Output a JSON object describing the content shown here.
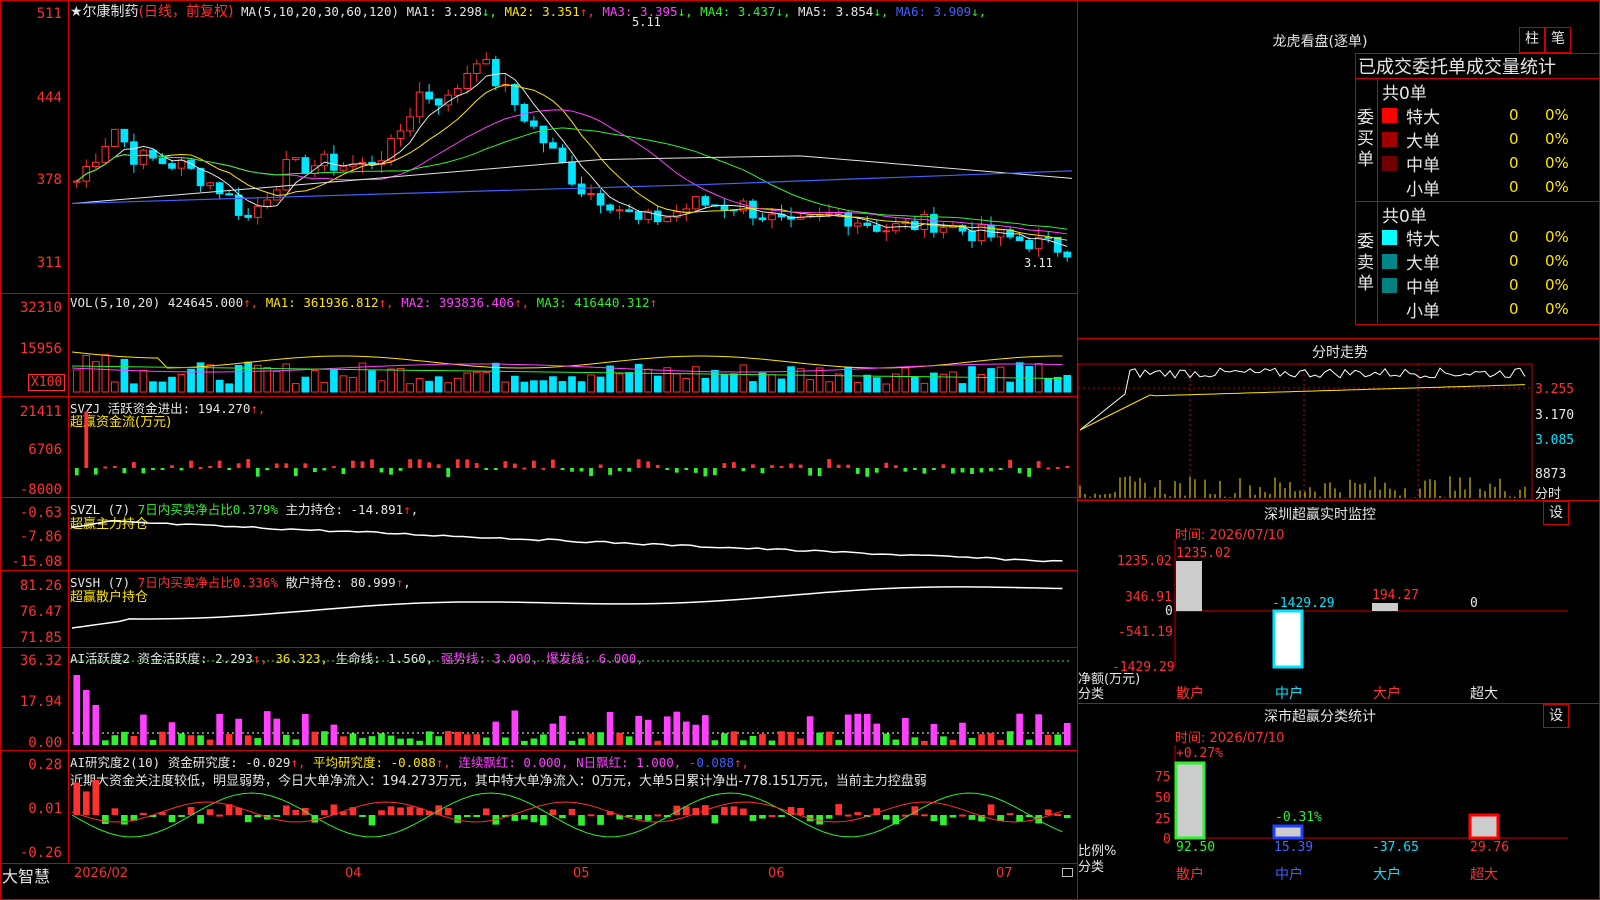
{
  "main": {
    "title": "★尔康制药",
    "mode": "(日线，前复权)",
    "ma_param": "MA(5,10,20,30,60,120)",
    "ma": [
      {
        "label": "MA1:",
        "value": "3.298",
        "arrow": "↓",
        "color": "#e6e6e6"
      },
      {
        "label": "MA2:",
        "value": "3.351",
        "arrow": "↑",
        "color": "#ffe600"
      },
      {
        "label": "MA3:",
        "value": "3.395",
        "arrow": "↓",
        "color": "#ff40ff"
      },
      {
        "label": "MA4:",
        "value": "3.437",
        "arrow": "↓",
        "color": "#2ef02e"
      },
      {
        "label": "MA5:",
        "value": "3.854",
        "arrow": "↓",
        "color": "#e6e6e6"
      },
      {
        "label": "MA6:",
        "value": "3.909",
        "arrow": "↓",
        "color": "#4060ff"
      }
    ],
    "high_label": "5.11",
    "low_label": "3.11",
    "yticks": [
      "511",
      "444",
      "378",
      "311"
    ]
  },
  "vol": {
    "param": "VOL(5,10,20)",
    "value": "424645.000",
    "ma1": "MA1: 361936.812",
    "ma2": "MA2: 393836.406",
    "ma3": "MA3: 416440.312",
    "yticks": [
      "32310",
      "15956"
    ],
    "unit": "X100"
  },
  "svzj": {
    "line1": "SVZJ  活跃资金进出: 194.270",
    "line2": "超赢资金流(万元)",
    "yticks": [
      "21411",
      "6706",
      "-8000"
    ]
  },
  "svzl": {
    "name": "SVZL (7)",
    "ratio": "7日内买卖净占比0.379%",
    "hold": "主力持仓: -14.891",
    "line2": "超赢主力持仓",
    "yticks": [
      "-0.63",
      "-7.86",
      "-15.08"
    ]
  },
  "svsh": {
    "name": "SVSH (7)",
    "ratio": "7日内买卖净占比0.336%",
    "hold": "散户持仓: 80.999",
    "line2": "超赢散户持仓",
    "yticks": [
      "81.26",
      "76.47",
      "71.85"
    ]
  },
  "ai1": {
    "name": "AI活跃度2",
    "act": "资金活跃度: 2.293",
    "v2": "36.323,",
    "life": "生命线: 1.560,",
    "strong": "强势线: 3.000,",
    "burst": "爆发线: 6.000,",
    "yticks": [
      "36.32",
      "17.94",
      "0.00"
    ]
  },
  "ai2": {
    "name": "AI研究度2(10)",
    "res": "资金研究度: -0.029",
    "avg": "平均研究度: -0.088",
    "red": "连续飘红: 0.000,",
    "nred": "N日飘红: 1.000,",
    "last": "-0.088",
    "comment": "近期大资金关注度较低，明显弱势，今日大单净流入：194.273万元，其中特大单净流入：0万元，大单5日累计净出-778.151万元，当前主力控盘弱",
    "yticks": [
      "0.28",
      "0.01",
      "-0.26"
    ]
  },
  "xaxis": {
    "brand": "大智慧",
    "labels": [
      "2026/02",
      "04",
      "05",
      "06",
      "07"
    ]
  },
  "right": {
    "lhb_title": "龙虎看盘(逐单)",
    "btn_zhu": "柱",
    "btn_bi": "笔",
    "order_title": "已成交委托单成交量统计",
    "buy_label": "委买单",
    "sell_label": "委卖单",
    "buy_total": "共0单",
    "sell_total": "共0单",
    "buy_rows": [
      {
        "name": "特大",
        "count": "0",
        "pct": "0%",
        "color": "#ff0000"
      },
      {
        "name": "大单",
        "count": "0",
        "pct": "0%",
        "color": "#a00000"
      },
      {
        "name": "中单",
        "count": "0",
        "pct": "0%",
        "color": "#700000"
      },
      {
        "name": "小单",
        "count": "0",
        "pct": "0%",
        "color": "#000000"
      }
    ],
    "sell_rows": [
      {
        "name": "特大",
        "count": "0",
        "pct": "0%",
        "color": "#00ffff"
      },
      {
        "name": "大单",
        "count": "0",
        "pct": "0%",
        "color": "#008888"
      },
      {
        "name": "中单",
        "count": "0",
        "pct": "0%",
        "color": "#008080"
      },
      {
        "name": "小单",
        "count": "0",
        "pct": "0%",
        "color": "#000000"
      }
    ],
    "fenshi_title": "分时走势",
    "fenshi_prices": [
      "3.255",
      "3.170",
      "3.085"
    ],
    "fenshi_vol": "8873",
    "fenshi_unit": "分时",
    "sz_title": "深圳超赢实时监控",
    "sz_btn": "设",
    "sz_time": "时间: 2026/07/10",
    "sz_yticks": [
      "1235.02",
      "346.91",
      "0",
      "-541.19",
      "-1429.29"
    ],
    "sz_axis1": "净额(万元)",
    "sz_axis2": "分类",
    "sz_cats": [
      "散户",
      "中户",
      "大户",
      "超大"
    ],
    "sz_values": [
      "1235.02",
      "-1429.29",
      "194.27",
      "0"
    ],
    "cls_title": "深市超赢分类统计",
    "cls_btn": "设",
    "cls_time": "时间: 2026/07/10",
    "cls_yticks": [
      "75",
      "50",
      "25",
      "0"
    ],
    "cls_axis1": "比例%",
    "cls_axis2": "分类",
    "cls_cats": [
      "散户",
      "中户",
      "大户",
      "超大"
    ],
    "cls_values": [
      "92.50",
      "15.39",
      "-37.65",
      "29.76"
    ],
    "cls_changes": [
      "+0.27%",
      "-0.31%"
    ]
  }
}
